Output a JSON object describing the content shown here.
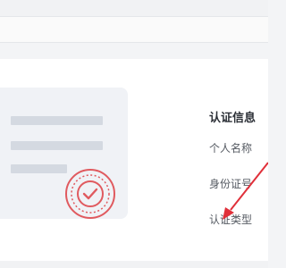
{
  "info": {
    "title": "认证信息",
    "fields": [
      {
        "label": "个人名称"
      },
      {
        "label": "身份证号"
      },
      {
        "label": "认证类型"
      }
    ]
  },
  "illustration": {
    "stamp_icon": "verified-check-seal",
    "stamp_color": "#e05a5f"
  },
  "annotation": {
    "arrow_color": "#e0303a"
  }
}
